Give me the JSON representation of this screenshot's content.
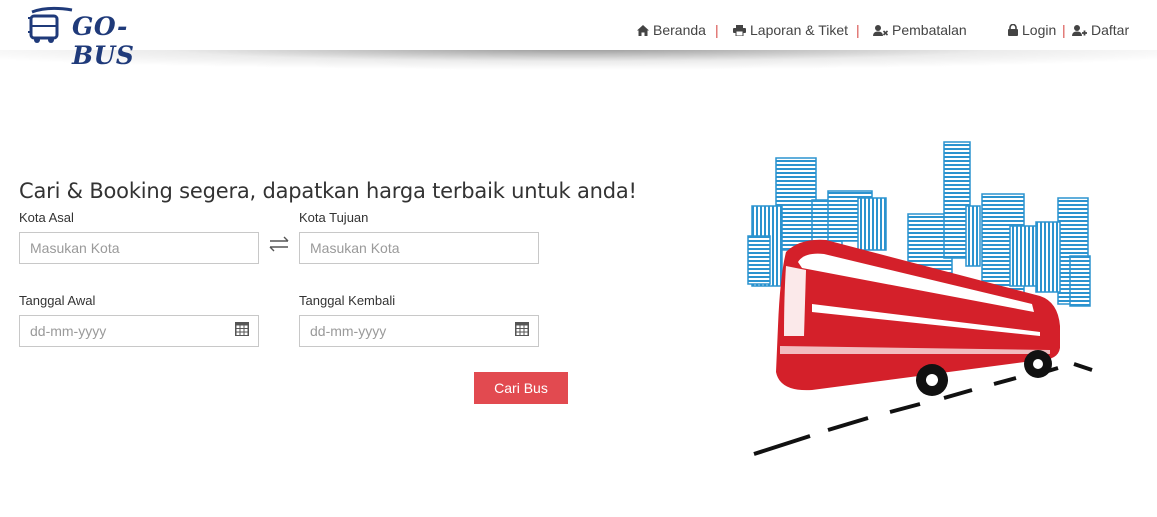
{
  "brand": {
    "name": "GO-BUS"
  },
  "nav": {
    "home": {
      "label": "Beranda",
      "icon": "home-icon"
    },
    "report": {
      "label": "Laporan & Tiket",
      "icon": "printer-icon"
    },
    "cancel": {
      "label": "Pembatalan",
      "icon": "user-remove-icon"
    },
    "login": {
      "label": "Login",
      "icon": "lock-icon"
    },
    "register": {
      "label": "Daftar",
      "icon": "user-add-icon"
    },
    "separator": "|"
  },
  "search": {
    "headline": "Cari & Booking segera, dapatkan harga terbaik untuk anda!",
    "origin": {
      "label": "Kota Asal",
      "placeholder": "Masukan Kota",
      "value": ""
    },
    "destination": {
      "label": "Kota Tujuan",
      "placeholder": "Masukan Kota",
      "value": ""
    },
    "depart_date": {
      "label": "Tanggal Awal",
      "placeholder": "dd-mm-yyyy",
      "value": ""
    },
    "return_date": {
      "label": "Tanggal Kembali",
      "placeholder": "dd-mm-yyyy",
      "value": ""
    },
    "submit_label": "Cari Bus"
  },
  "colors": {
    "brand_blue": "#1f3a7a",
    "accent_red": "#e24a50",
    "separator_red": "#d9534f",
    "building_blue": "#2b93cf",
    "bus_red": "#d4202a"
  }
}
